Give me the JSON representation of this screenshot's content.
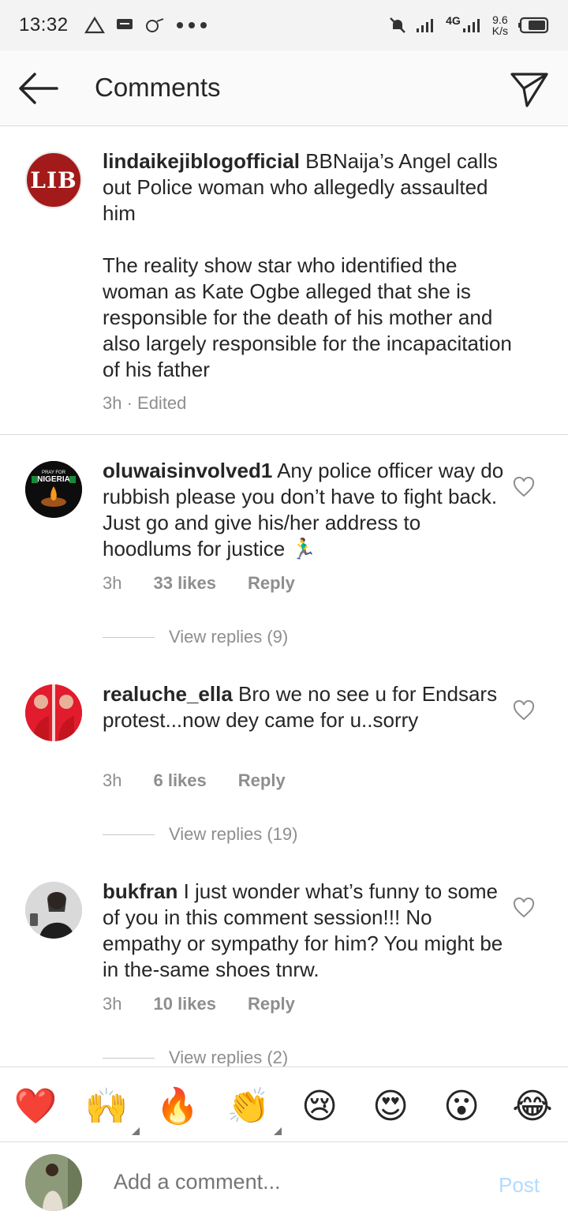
{
  "status_bar": {
    "time": "13:32",
    "network": "4G",
    "speed_value": "9.6",
    "speed_unit": "K/s"
  },
  "header": {
    "title": "Comments",
    "back_icon": "arrow-left-icon",
    "send_icon": "paper-plane-icon"
  },
  "caption": {
    "avatar_text": "LIB",
    "username": "lindaikejiblogofficial",
    "text_line1": "BBNaija’s Angel calls out Police woman who allegedly assaulted him",
    "text_line2": "The reality show star who identified the woman as Kate Ogbe alleged that she is responsible for the death of his mother and also largely responsible for the incapacitation of his father",
    "meta": "3h · Edited"
  },
  "comments": [
    {
      "username": "oluwaisinvolved1",
      "text": "Any police officer way do rubbish please you don’t have to fight back. Just go and give his/her address to hoodlums for justice 🏃‍♂️",
      "time": "3h",
      "likes": "33 likes",
      "reply": "Reply",
      "view_replies": "View replies (9)",
      "avatar_small_text": "PRAY FOR",
      "avatar_big_text": "NIGERIA"
    },
    {
      "username": "realuche_ella",
      "text": "Bro we no see u for Endsars protest...now dey came for u..sorry",
      "time": "3h",
      "likes": "6 likes",
      "reply": "Reply",
      "view_replies": "View replies (19)"
    },
    {
      "username": "bukfran",
      "text": "I just wonder what’s funny to some of you in this comment session!!! No empathy or sympathy for him? You might be in the-same shoes tnrw.",
      "time": "3h",
      "likes": "10 likes",
      "reply": "Reply",
      "view_replies": "View replies (2)"
    }
  ],
  "emoji_bar": [
    "❤️",
    "🙌",
    "🔥",
    "👏",
    "😢",
    "😍",
    "😮",
    "😂"
  ],
  "add_comment": {
    "placeholder": "Add a comment...",
    "post_label": "Post"
  },
  "colors": {
    "text": "#262626",
    "muted": "#8e8e8e",
    "divider": "#dbdbdb",
    "post_disabled": "#b3dbff",
    "lib_red": "#a31a1a"
  }
}
